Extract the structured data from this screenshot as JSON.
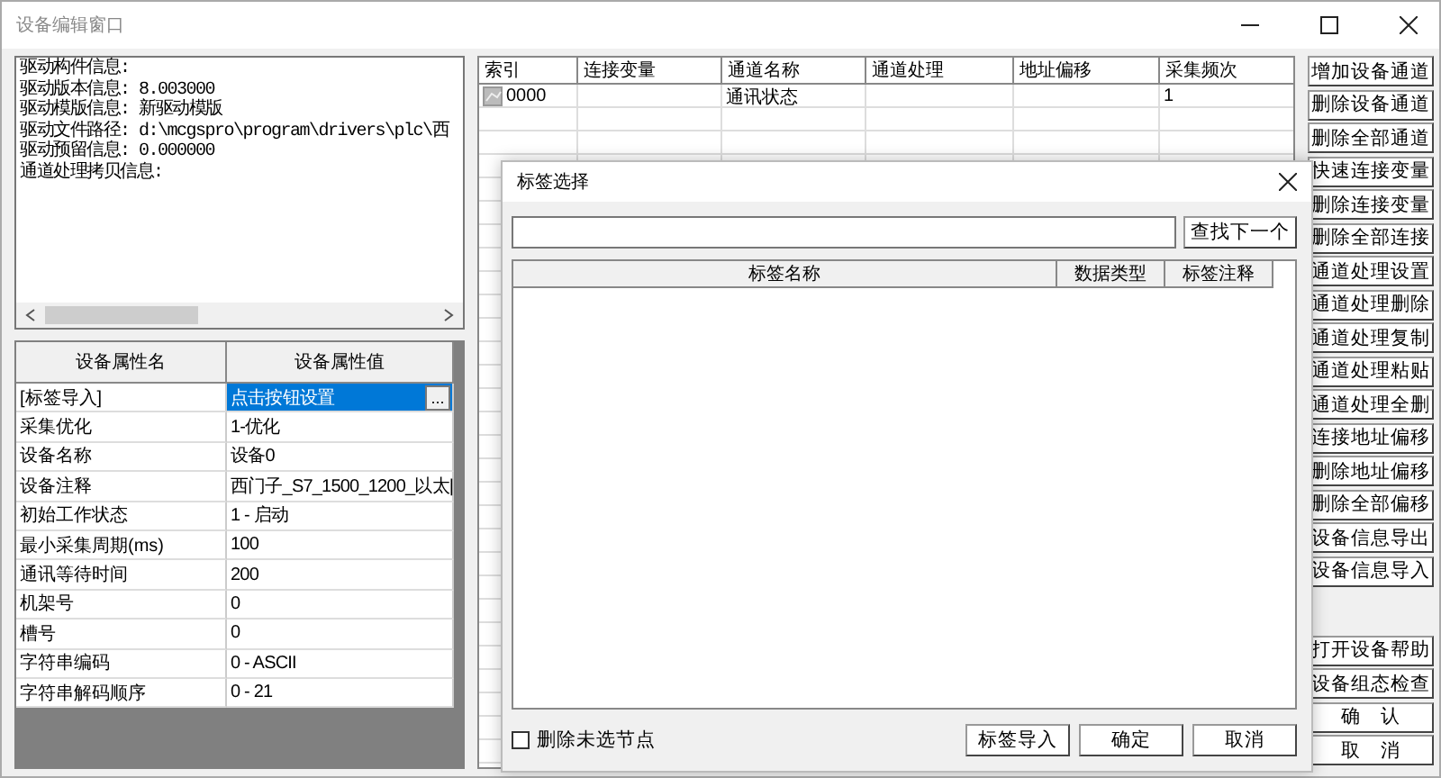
{
  "window": {
    "title": "设备编辑窗口"
  },
  "info_lines": [
    "驱动构件信息:",
    "驱动版本信息: 8.003000",
    "驱动模版信息: 新驱动模版",
    "驱动文件路径: d:\\mcgspro\\program\\drivers\\plc\\西",
    "驱动预留信息: 0.000000",
    "通道处理拷贝信息:"
  ],
  "properties": {
    "columns": [
      "设备属性名",
      "设备属性值"
    ],
    "rows": [
      {
        "name": "[标签导入]",
        "value": "点击按钮设置",
        "selected": true,
        "button": "..."
      },
      {
        "name": "采集优化",
        "value": "1-优化",
        "selected": false
      },
      {
        "name": "设备名称",
        "value": "设备0",
        "selected": false
      },
      {
        "name": "设备注释",
        "value": "西门子_S7_1500_1200_以太|",
        "selected": false
      },
      {
        "name": "初始工作状态",
        "value": "1 - 启动",
        "selected": false
      },
      {
        "name": "最小采集周期(ms)",
        "value": "100",
        "selected": false
      },
      {
        "name": "通讯等待时间",
        "value": "200",
        "selected": false
      },
      {
        "name": "机架号",
        "value": "0",
        "selected": false
      },
      {
        "name": "槽号",
        "value": "0",
        "selected": false
      },
      {
        "name": "字符串编码",
        "value": "0 - ASCII",
        "selected": false
      },
      {
        "name": "字符串解码顺序",
        "value": "0 - 21",
        "selected": false
      }
    ]
  },
  "channels": {
    "columns": [
      "索引",
      "连接变量",
      "通道名称",
      "通道处理",
      "地址偏移",
      "采集频次"
    ],
    "rows": [
      {
        "cells": [
          "0000",
          "",
          "通讯状态",
          "",
          "",
          "1"
        ]
      }
    ]
  },
  "side_buttons": {
    "upper": [
      "增加设备通道",
      "删除设备通道",
      "删除全部通道",
      "快速连接变量",
      "删除连接变量",
      "删除全部连接",
      "通道处理设置",
      "通道处理删除",
      "通道处理复制",
      "通道处理粘贴",
      "通道处理全删",
      "连接地址偏移",
      "删除地址偏移",
      "删除全部偏移",
      "设备信息导出",
      "设备信息导入"
    ],
    "lower": [
      "打开设备帮助",
      "设备组态检查",
      "确　认",
      "取　消"
    ]
  },
  "dialog": {
    "title": "标签选择",
    "find_button": "查找下一个",
    "columns": [
      "标签名称",
      "数据类型",
      "标签注释"
    ],
    "delete_unselected": {
      "label": "删除未选节点",
      "checked": false
    },
    "buttons": [
      "标签导入",
      "确定",
      "取消"
    ]
  }
}
